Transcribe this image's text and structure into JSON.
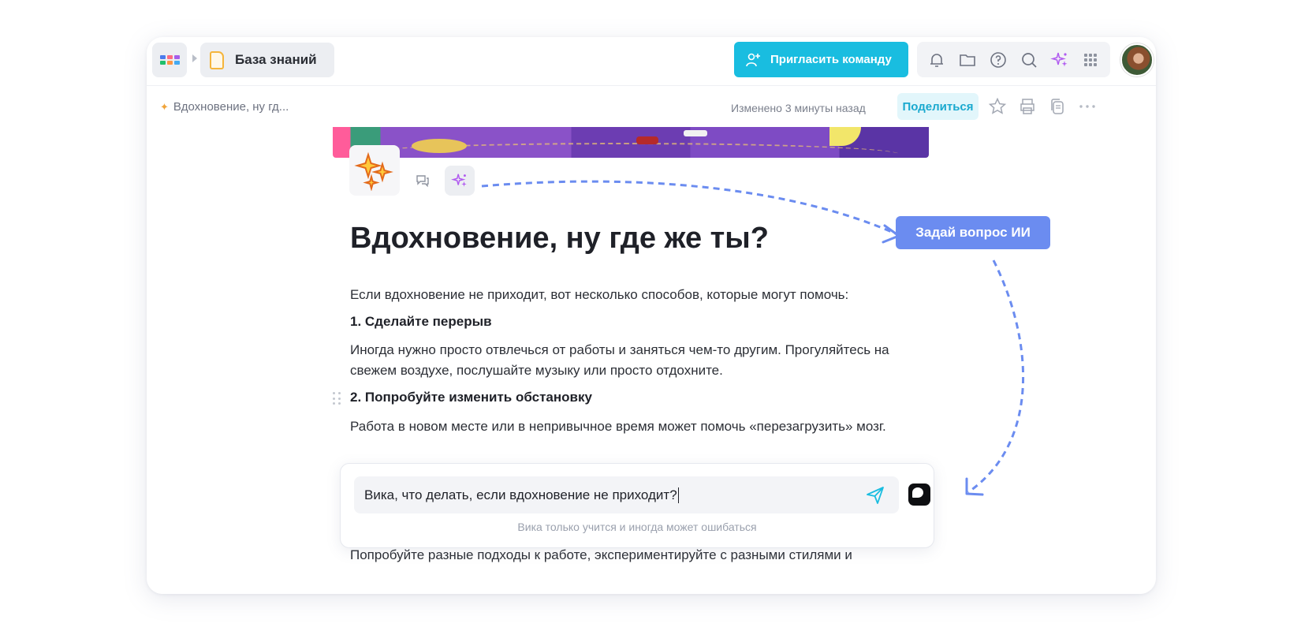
{
  "header": {
    "breadcrumb_label": "База знаний",
    "invite_label": "Пригласить команду",
    "toolbar_icons": [
      "bell-icon",
      "folder-icon",
      "help-icon",
      "search-icon",
      "sparkles-icon",
      "apps-grid-icon"
    ]
  },
  "subheader": {
    "page_path": "Вдохновение, ну гд...",
    "changed": "Изменено 3 минуты назад",
    "share_label": "Поделиться"
  },
  "doc": {
    "title": "Вдохновение, ну где же ты?",
    "intro": "Если вдохновение не приходит, вот несколько способов, которые могут помочь:",
    "h1": "1. Сделайте перерыв",
    "p1": "Иногда нужно просто отвлечься от работы и заняться чем-то другим. Прогуляйтесь на свежем воздухе, послушайте музыку или просто отдохните.",
    "h2": "2. Попробуйте изменить обстановку",
    "p2": "Работа в новом месте или в непривычное время может помочь «перезагрузить» мозг.",
    "p3": "Попробуйте разные подходы к работе, экспериментируйте с разными стилями и"
  },
  "chat": {
    "input_value": "Вика, что делать, если вдохновение не приходит?",
    "note": "Вика только учится и иногда может ошибаться"
  },
  "callout": {
    "label": "Задай вопрос ИИ"
  },
  "colors": {
    "accent": "#19bde0",
    "callout": "#6b8cf0",
    "share_bg": "#e2f6fb"
  }
}
